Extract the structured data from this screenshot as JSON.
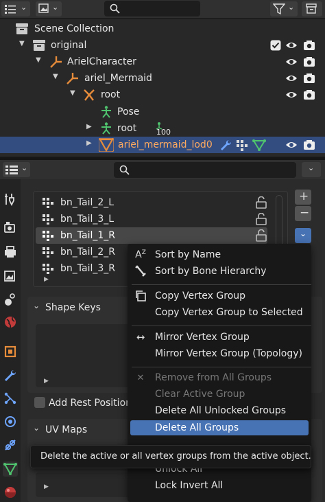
{
  "outliner": {
    "search_placeholder": "",
    "items": [
      {
        "label": "Scene Collection"
      },
      {
        "label": "original"
      },
      {
        "label": "ArielCharacter"
      },
      {
        "label": "ariel_Mermaid"
      },
      {
        "label": "root"
      },
      {
        "label": "Pose"
      },
      {
        "label": "root",
        "badge": "100"
      },
      {
        "label": "ariel_mermaid_lod0"
      }
    ]
  },
  "properties": {
    "search_placeholder": "",
    "vertex_groups": [
      "bn_Tail_2_L",
      "bn_Tail_3_L",
      "bn_Tail_1_R",
      "bn_Tail_2_R",
      "bn_Tail_3_R"
    ],
    "panels": {
      "shape_keys": "Shape Keys",
      "add_rest_position": "Add Rest Position",
      "uv_maps": "UV Maps"
    }
  },
  "context_menu": {
    "items": [
      {
        "label": "Sort by Name",
        "icon": "sort-alpha-icon"
      },
      {
        "label": "Sort by Bone Hierarchy",
        "icon": "bone-icon"
      },
      {
        "label": "Copy Vertex Group",
        "icon": "copy-icon"
      },
      {
        "label": "Copy Vertex Group to Selected",
        "icon": ""
      },
      {
        "label": "Mirror Vertex Group",
        "icon": "mirror-arrows-icon"
      },
      {
        "label": "Mirror Vertex Group (Topology)",
        "icon": ""
      },
      {
        "label": "Remove from All Groups",
        "icon": "x-icon"
      },
      {
        "label": "Clear Active Group",
        "icon": ""
      },
      {
        "label": "Delete All Unlocked Groups",
        "icon": ""
      },
      {
        "label": "Delete All Groups",
        "icon": ""
      },
      {
        "label": "Unlock All",
        "icon": ""
      },
      {
        "label": "Lock Invert All",
        "icon": ""
      }
    ]
  },
  "tooltip": {
    "text": "Delete the active or all vertex groups from the active object."
  },
  "colors": {
    "selection": "#334d80",
    "menu_highlight": "#4772b3",
    "accent_orange": "#e78c3b",
    "accent_green": "#4fc36e"
  }
}
